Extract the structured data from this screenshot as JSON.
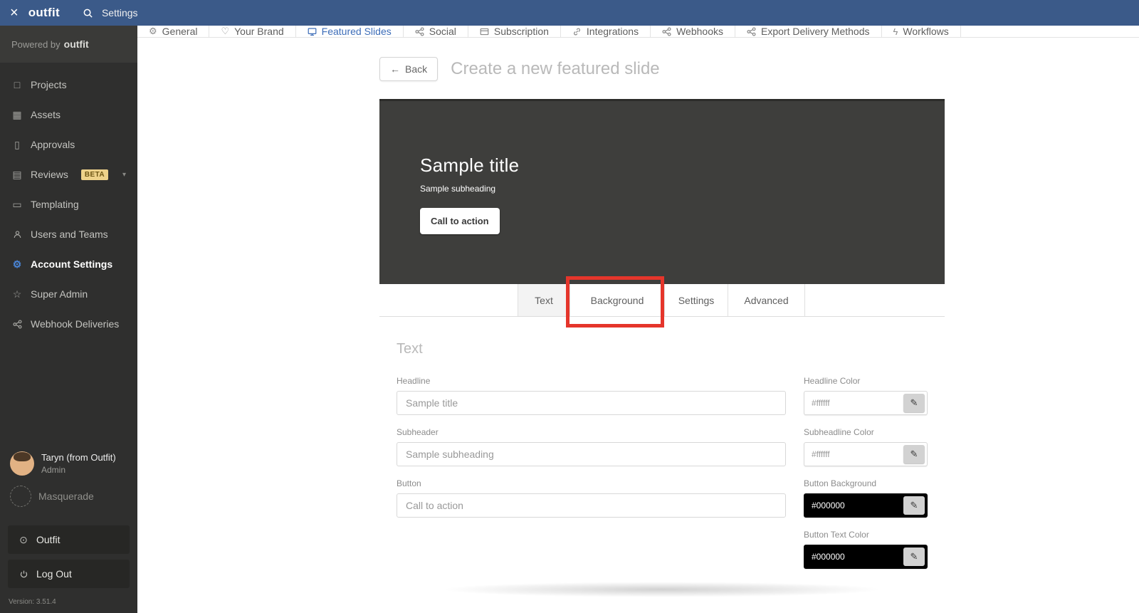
{
  "topbar": {
    "logo": "outfit",
    "title": "Settings"
  },
  "sidebar": {
    "powered_by": "Powered by",
    "powered_logo": "outfit",
    "items": [
      {
        "label": "Projects"
      },
      {
        "label": "Assets"
      },
      {
        "label": "Approvals"
      },
      {
        "label": "Reviews",
        "badge": "BETA"
      },
      {
        "label": "Templating"
      },
      {
        "label": "Users and Teams"
      },
      {
        "label": "Account Settings"
      },
      {
        "label": "Super Admin"
      },
      {
        "label": "Webhook Deliveries"
      }
    ],
    "user": {
      "name": "Taryn (from Outfit)",
      "role": "Admin"
    },
    "masquerade_label": "Masquerade",
    "outfit_button": "Outfit",
    "logout_button": "Log Out",
    "version": "Version: 3.51.4"
  },
  "tabs": [
    {
      "label": "General"
    },
    {
      "label": "Your Brand"
    },
    {
      "label": "Featured Slides"
    },
    {
      "label": "Social"
    },
    {
      "label": "Subscription"
    },
    {
      "label": "Integrations"
    },
    {
      "label": "Webhooks"
    },
    {
      "label": "Export Delivery Methods"
    },
    {
      "label": "Workflows"
    }
  ],
  "content": {
    "back_label": "Back",
    "page_title": "Create a new featured slide",
    "preview": {
      "title": "Sample title",
      "subheading": "Sample subheading",
      "cta": "Call to action"
    },
    "editor_tabs": [
      "Text",
      "Background",
      "Settings",
      "Advanced"
    ],
    "section_title": "Text",
    "fields": {
      "headline": {
        "label": "Headline",
        "value": "Sample title"
      },
      "headline_color": {
        "label": "Headline Color",
        "value": "#ffffff"
      },
      "subheader": {
        "label": "Subheader",
        "value": "Sample subheading"
      },
      "subheadline_color": {
        "label": "Subheadline Color",
        "value": "#ffffff"
      },
      "button": {
        "label": "Button",
        "value": "Call to action"
      },
      "button_background": {
        "label": "Button Background",
        "value": "#000000"
      },
      "button_text_color": {
        "label": "Button Text Color",
        "value": "#000000"
      }
    }
  },
  "colors": {
    "topbar_blue": "#3b5a89",
    "sidebar_dark": "#2f2f2e",
    "accent_blue": "#3d6db8",
    "annotation_red": "#e5352b",
    "beta_badge": "#eed28a",
    "preview_background": "#3e3e3c"
  }
}
